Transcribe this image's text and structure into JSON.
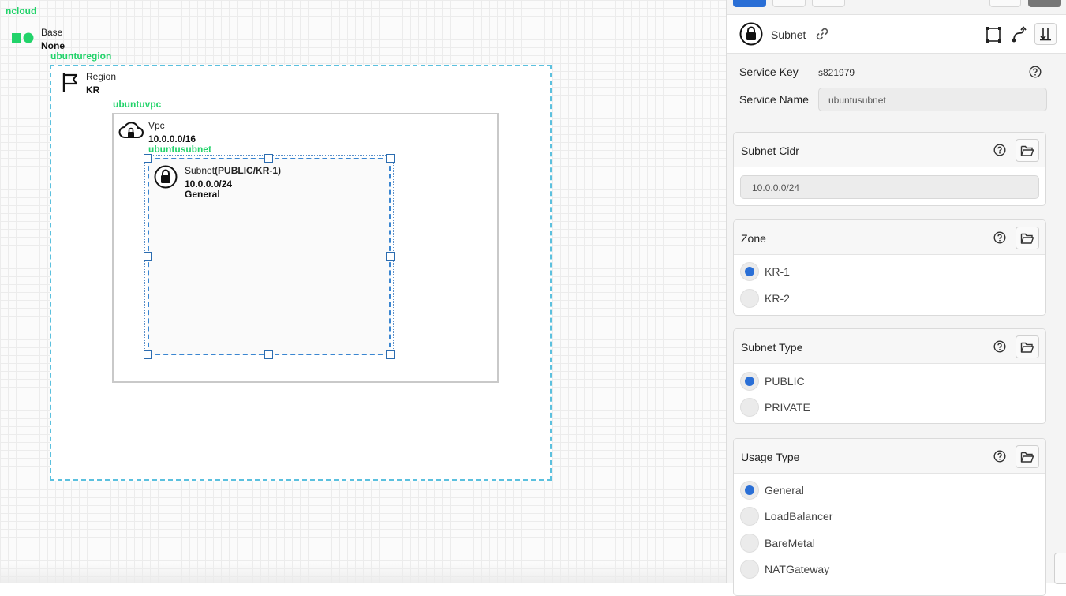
{
  "canvas": {
    "root_label": "ncloud",
    "base": {
      "title": "Base",
      "value": "None"
    },
    "region": {
      "label": "ubunturegion",
      "title": "Region",
      "value": "KR"
    },
    "vpc": {
      "label": "ubuntuvpc",
      "title": "Vpc",
      "cidr": "10.0.0.0/16"
    },
    "subnet": {
      "label": "ubuntusubnet",
      "title": "Subnet",
      "qualifier": "(PUBLIC/KR-1)",
      "cidr": "10.0.0.0/24",
      "usage": "General"
    }
  },
  "panel": {
    "header_title": "Subnet",
    "service_key": {
      "label": "Service Key",
      "value": "s821979"
    },
    "service_name": {
      "label": "Service Name",
      "value": "ubuntusubnet"
    },
    "subnet_cidr": {
      "title": "Subnet Cidr",
      "value": "10.0.0.0/24"
    },
    "zone": {
      "title": "Zone",
      "options": [
        {
          "label": "KR-1",
          "checked": true
        },
        {
          "label": "KR-2",
          "checked": false
        }
      ]
    },
    "subnet_type": {
      "title": "Subnet Type",
      "options": [
        {
          "label": "PUBLIC",
          "checked": true
        },
        {
          "label": "PRIVATE",
          "checked": false
        }
      ]
    },
    "usage_type": {
      "title": "Usage Type",
      "options": [
        {
          "label": "General",
          "checked": true
        },
        {
          "label": "LoadBalancer",
          "checked": false
        },
        {
          "label": "BareMetal",
          "checked": false
        },
        {
          "label": "NATGateway",
          "checked": false
        }
      ]
    }
  },
  "colors": {
    "accent_blue": "#2a6fd6",
    "label_green": "#22d36a",
    "region_border": "#5bc0de",
    "subnet_border": "#3a86d1"
  },
  "icons": {
    "base": "ncloud-logo-icon",
    "region": "flag-icon",
    "vpc": "cloud-lock-icon",
    "subnet": "lock-icon",
    "link": "link-icon",
    "help": "question-circle-icon",
    "folder": "folder-open-icon",
    "resize": "bounding-box-icon",
    "connector": "connector-icon",
    "sort": "sort-down-icon"
  }
}
